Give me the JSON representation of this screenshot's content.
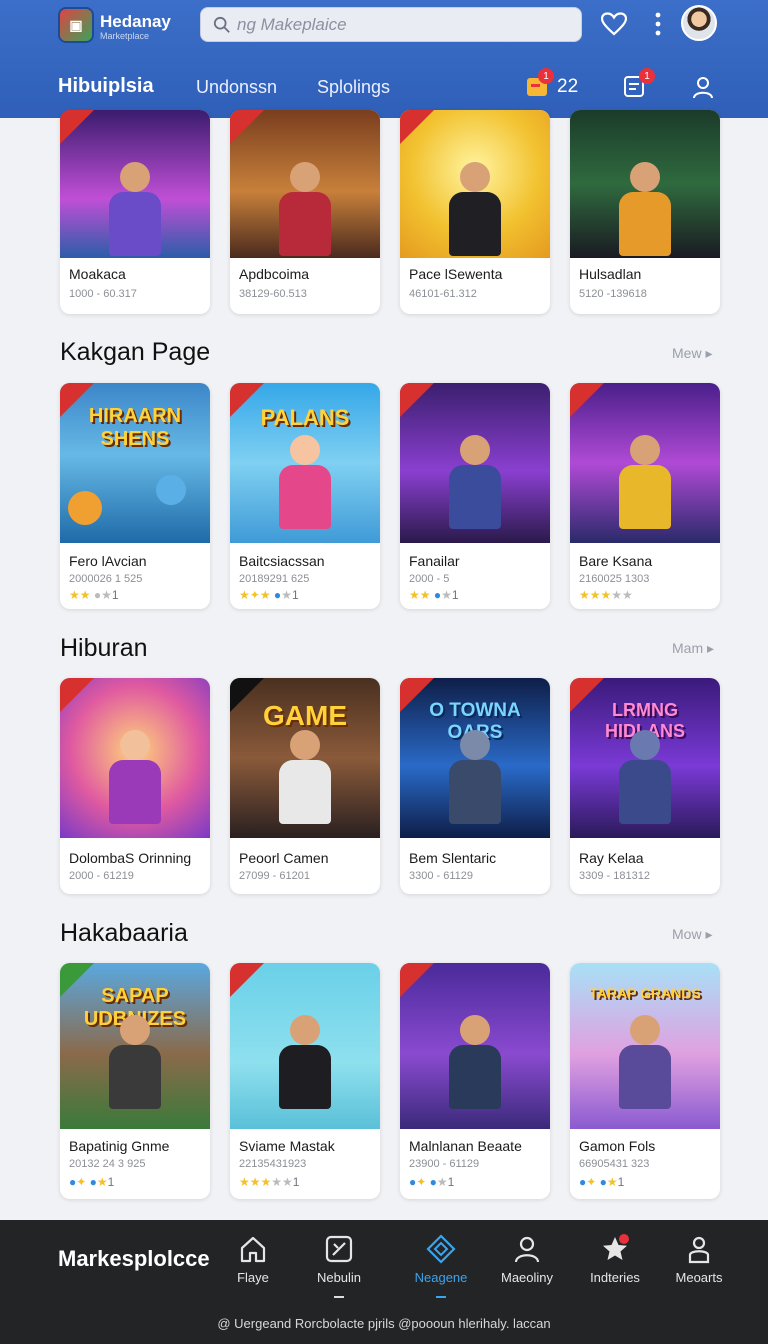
{
  "header": {
    "brand_name": "Hedanay",
    "brand_sub": "Marketplace",
    "search_placeholder": "ng Makeplaice",
    "nav_title": "Hibuiplsia",
    "nav_links": [
      "Undonssn",
      "Splolings"
    ],
    "cart_count": "22",
    "badge_one": "1",
    "badge_two": "1"
  },
  "row0": {
    "cards": [
      {
        "name": "Moakaca",
        "num": "1000 - 60.317"
      },
      {
        "name": "Apdbcoima",
        "num": "38129-60.513"
      },
      {
        "name": "Pace lSewenta",
        "num": "46101-61.312"
      },
      {
        "name": "Hulsadlan",
        "num": "5120 -139618"
      }
    ]
  },
  "sections": [
    {
      "title": "Kakgan Page",
      "more": "Mew",
      "cards": [
        {
          "name": "Fero lAvcian",
          "num": "2000026 1 525",
          "rating": "1",
          "ttl": "HIRAARN SHENS"
        },
        {
          "name": "Baitcsiacssan",
          "num": "20189291 625",
          "rating": "1",
          "ttl": "PALANS"
        },
        {
          "name": "Fanailar",
          "num": "2000 - 5",
          "rating": "1",
          "ttl": ""
        },
        {
          "name": "Bare Ksana",
          "num": "2160025 1303",
          "rating": "",
          "ttl": ""
        }
      ]
    },
    {
      "title": "Hiburan",
      "more": "Mam",
      "cards": [
        {
          "name": "DolombaS Orinning",
          "num": "2000 - 61219",
          "ttl": ""
        },
        {
          "name": "Peoorl Camen",
          "num": "27099 - 61201",
          "ttl": "GAME"
        },
        {
          "name": "Bem Slentaric",
          "num": "3300 - 61129",
          "ttl": "O TOWNA OARS"
        },
        {
          "name": "Ray Kelaa",
          "num": "3309 - 181312",
          "ttl": "LRMNG HIDLANS"
        }
      ]
    },
    {
      "title": "Hakabaaria",
      "more": "Mow",
      "cards": [
        {
          "name": "Bapatinig Gnme",
          "num": "20132 24 3 925",
          "rating": "1",
          "ttl": "SAPAP UDBNIZES"
        },
        {
          "name": "Sviame Mastak",
          "num": "22135431923",
          "rating": "1",
          "ttl": ""
        },
        {
          "name": "Malnlanan Beaate",
          "num": "23900 - 61129",
          "rating": "1",
          "ttl": ""
        },
        {
          "name": "Gamon Fols",
          "num": "66905431 323",
          "rating": "1",
          "ttl": "TARAP GRANDS"
        }
      ]
    }
  ],
  "bottom": {
    "title": "Markesplolcce",
    "items": [
      "Flaye",
      "Nebulin",
      "Neagene",
      "Maeoliny",
      "Indteries",
      "Meoarts"
    ],
    "footer": "@ Uergeand Rorcbolacte pjrils @poooun hlerihaly. laccan"
  },
  "colors": {
    "header": "#2f5fb8",
    "accent": "#3aa4ee",
    "badge": "#e8313b",
    "bottom_bar": "#232426"
  }
}
